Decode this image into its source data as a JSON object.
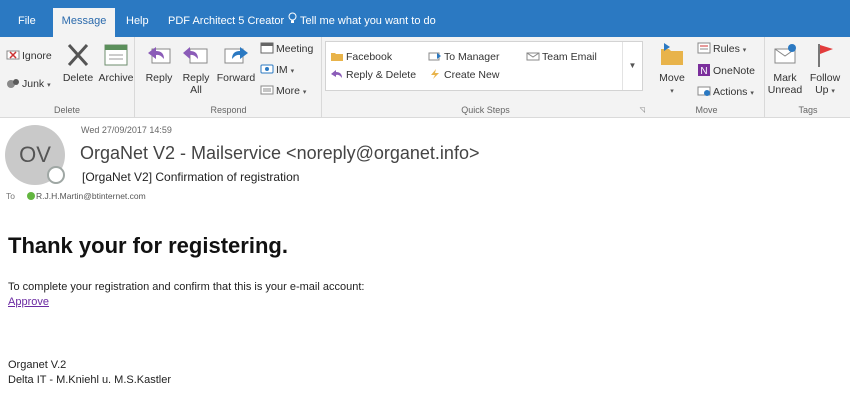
{
  "tabs": {
    "file": "File",
    "message": "Message",
    "help": "Help",
    "pdf": "PDF Architect 5 Creator",
    "tell": "Tell me what you want to do"
  },
  "ribbon": {
    "delete_group": {
      "label": "Delete",
      "ignore": "Ignore",
      "junk": "Junk",
      "delete": "Delete",
      "archive": "Archive"
    },
    "respond_group": {
      "label": "Respond",
      "reply": "Reply",
      "reply_all_1": "Reply",
      "reply_all_2": "All",
      "forward": "Forward",
      "meeting": "Meeting",
      "im": "IM",
      "more": "More"
    },
    "quick_steps": {
      "label": "Quick Steps",
      "items": [
        "Facebook",
        "To Manager",
        "Team Email",
        "Reply & Delete",
        "Create New"
      ]
    },
    "move_group": {
      "label": "Move",
      "move": "Move",
      "rules": "Rules",
      "onenote": "OneNote",
      "actions": "Actions"
    },
    "tags_group": {
      "label": "Tags",
      "mark_unread_1": "Mark",
      "mark_unread_2": "Unread",
      "follow_up_1": "Follow",
      "follow_up_2": "Up"
    }
  },
  "header": {
    "avatar_initials": "OV",
    "date": "Wed 27/09/2017 14:59",
    "sender": "OrgaNet V2 - Mailservice <noreply@organet.info>",
    "subject": "[OrgaNet V2] Confirmation of registration",
    "to_label": "To",
    "to_address": "R.J.H.Martin@btinternet.com"
  },
  "body": {
    "heading": "Thank your for registering.",
    "paragraph": "To complete your registration and confirm that this is your e-mail account:",
    "link": "Approve",
    "signature_line1": "Organet V.2",
    "signature_line2": "Delta IT - M.Kniehl u. M.S.Kastler"
  },
  "colors": {
    "accent": "#2b79c2",
    "link": "#6b2aa2",
    "presence": "#63b640"
  }
}
